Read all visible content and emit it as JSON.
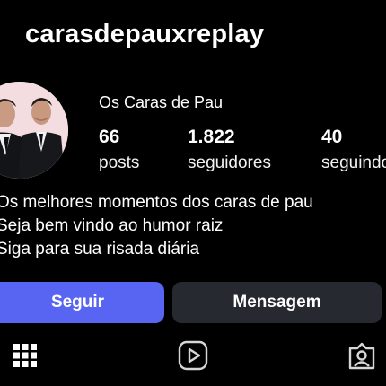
{
  "profile": {
    "username": "carasdepauxreplay",
    "display_name": "Os Caras de Pau",
    "avatar_icon": "avatar-photo-two-men-in-suits"
  },
  "stats": {
    "posts": {
      "value": "66",
      "label": "posts"
    },
    "followers": {
      "value": "1.822",
      "label": "seguidores"
    },
    "following": {
      "value": "40",
      "label": "seguindo"
    }
  },
  "bio": [
    "Os melhores momentos dos caras de pau",
    "Seja bem vindo ao humor raiz",
    "Siga para sua risada diária"
  ],
  "actions": {
    "follow_label": "Seguir",
    "message_label": "Mensagem"
  },
  "tabs": [
    {
      "icon": "grid-icon"
    },
    {
      "icon": "reels-icon"
    },
    {
      "icon": "tagged-icon"
    }
  ],
  "colors": {
    "background": "#000000",
    "follow_button": "#5865f2",
    "message_button": "#262a30",
    "text": "#ffffff"
  }
}
